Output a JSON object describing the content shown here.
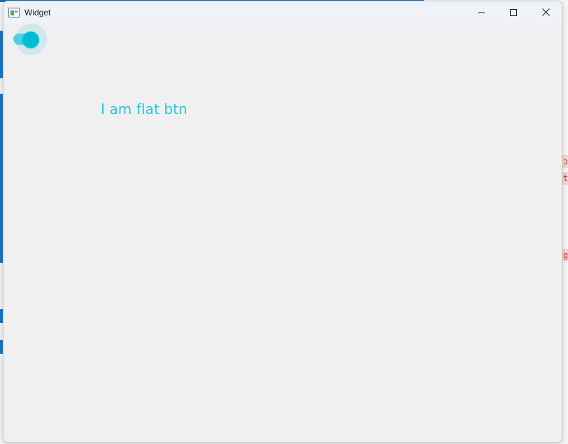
{
  "window": {
    "title": "Widget",
    "controls": {
      "minimize": "minimize-icon",
      "maximize": "maximize-icon",
      "close": "close-icon"
    }
  },
  "toggle": {
    "state": "on",
    "accent_color": "#00bcd4",
    "track_color": "#4dd0e1"
  },
  "flat_button": {
    "label": "I am flat btn",
    "color": "#26c6da"
  },
  "background": {
    "partial_chips": [
      "ɔ",
      "t",
      "g"
    ]
  }
}
